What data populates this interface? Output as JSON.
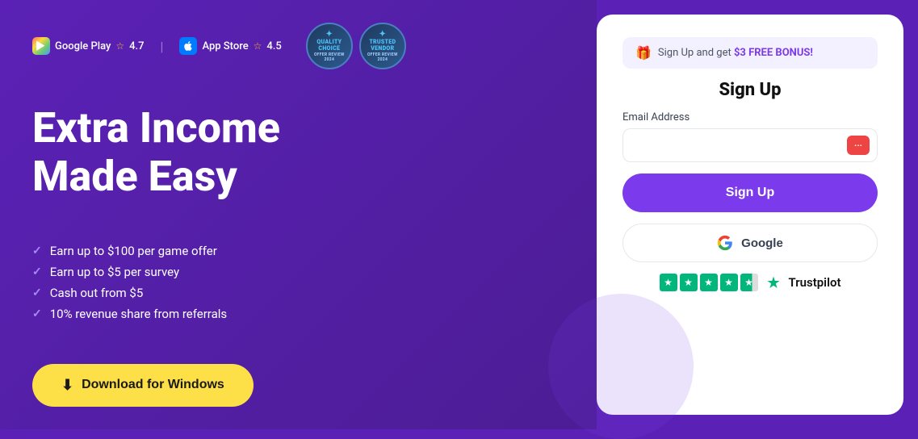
{
  "left": {
    "stores": [
      {
        "name": "Google Play",
        "rating": "4.7",
        "icon_type": "play"
      },
      {
        "name": "App Store",
        "rating": "4.5",
        "icon_type": "apple"
      }
    ],
    "awards": [
      {
        "title": "QUALITY\nCHOICE",
        "sub": "OFFER REVIEW - 2024"
      },
      {
        "title": "TRUSTED\nVENDOR",
        "sub": "OFFER REVIEW - 2024"
      }
    ],
    "heading_line1": "Extra Income",
    "heading_line2": "Made Easy",
    "features": [
      "Earn up to $100 per game offer",
      "Earn up to $5 per survey",
      "Cash out from $5",
      "10% revenue share from referrals"
    ],
    "download_button": "Download for Windows"
  },
  "right": {
    "bonus_text": "Sign Up and get ",
    "bonus_highlight": "$3 FREE BONUS!",
    "gift_icon": "🎁",
    "title": "Sign Up",
    "email_label": "Email Address",
    "email_placeholder": "",
    "signup_button": "Sign Up",
    "google_button": "Google",
    "trustpilot_label": "Trustpilot"
  }
}
